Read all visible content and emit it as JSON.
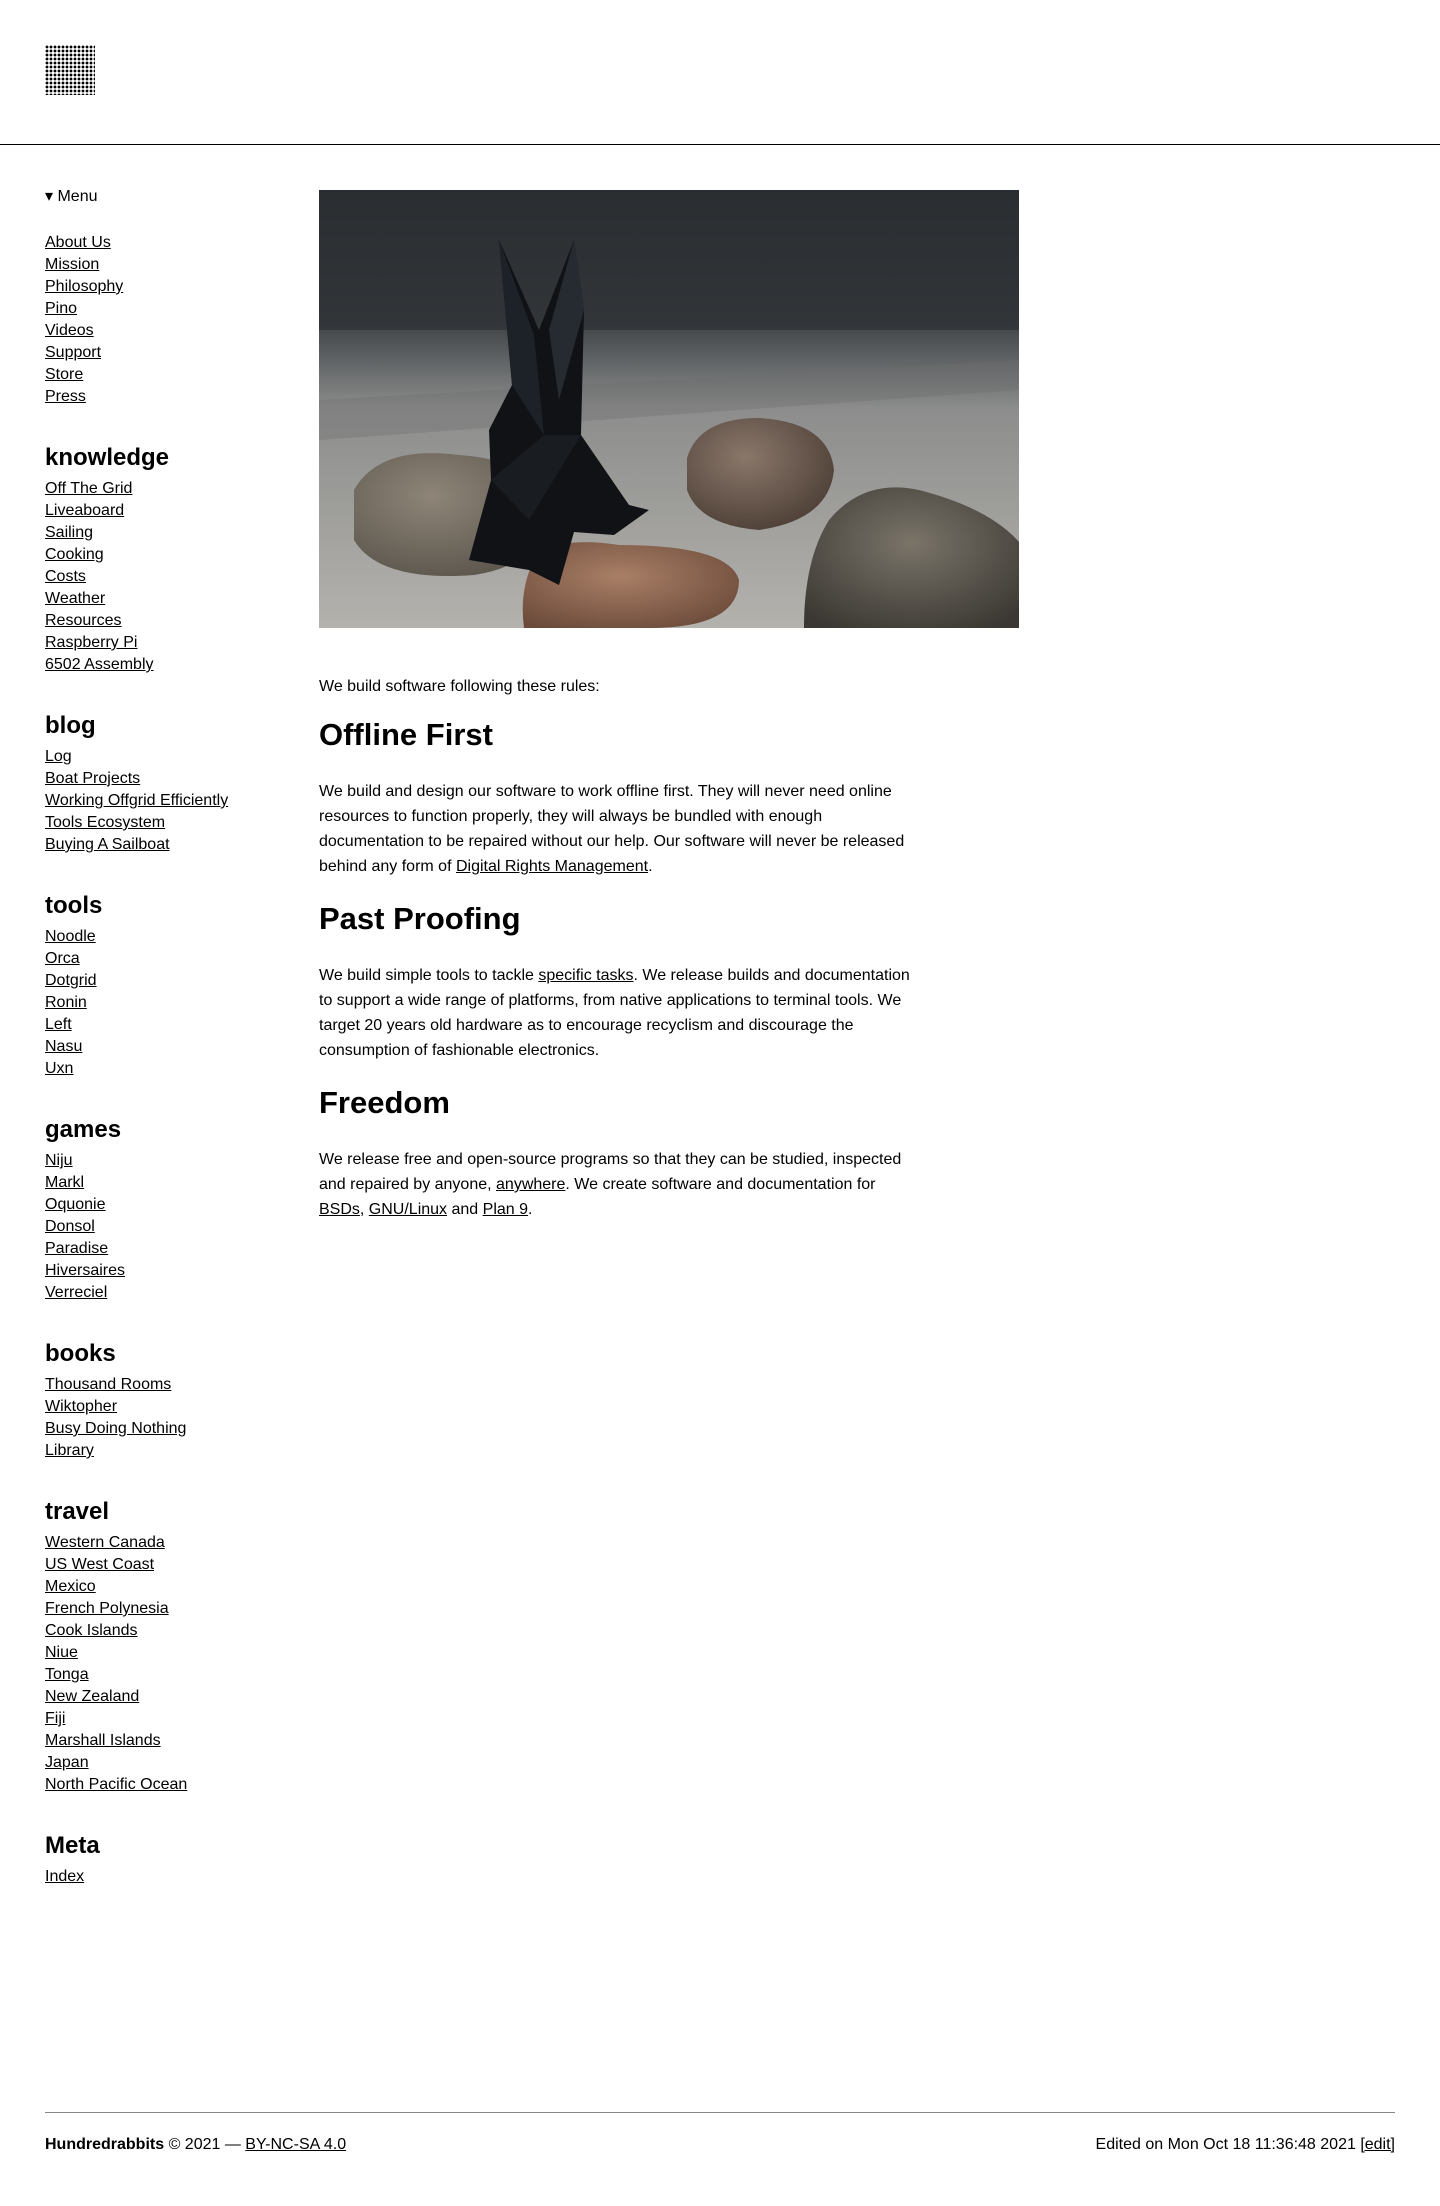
{
  "header": {
    "logo_icon": "dot-grid-logo-icon"
  },
  "nav": {
    "menu_label": "▾ Menu",
    "top_links": [
      "About Us",
      "Mission",
      "Philosophy",
      "Pino",
      "Videos",
      "Support",
      "Store",
      "Press"
    ],
    "groups": [
      {
        "title": "knowledge",
        "items": [
          "Off The Grid",
          "Liveaboard",
          "Sailing",
          "Cooking",
          "Costs",
          "Weather",
          "Resources",
          "Raspberry Pi",
          "6502 Assembly"
        ]
      },
      {
        "title": "blog",
        "items": [
          "Log",
          "Boat Projects",
          "Working Offgrid Efficiently",
          "Tools Ecosystem",
          "Buying A Sailboat"
        ]
      },
      {
        "title": "tools",
        "items": [
          "Noodle",
          "Orca",
          "Dotgrid",
          "Ronin",
          "Left",
          "Nasu",
          "Uxn"
        ]
      },
      {
        "title": "games",
        "items": [
          "Niju",
          "Markl",
          "Oquonie",
          "Donsol",
          "Paradise",
          "Hiversaires",
          "Verreciel"
        ]
      },
      {
        "title": "books",
        "items": [
          "Thousand Rooms",
          "Wiktopher",
          "Busy Doing Nothing",
          "Library"
        ]
      },
      {
        "title": "travel",
        "items": [
          "Western Canada",
          "US West Coast",
          "Mexico",
          "French Polynesia",
          "Cook Islands",
          "Niue",
          "Tonga",
          "New Zealand",
          "Fiji",
          "Marshall Islands",
          "Japan",
          "North Pacific Ocean"
        ]
      },
      {
        "title": "Meta",
        "items": [
          "Index"
        ]
      }
    ]
  },
  "main": {
    "intro": "We build software following these rules:",
    "sections": [
      {
        "title": "Offline First",
        "parts": [
          {
            "t": "We build and design our software to work offline first. They will never need online resources to function properly, they will always be bundled with enough documentation to be repaired without our help. Our software will never be released behind any form of "
          },
          {
            "t": "Digital Rights Management",
            "link": true
          },
          {
            "t": "."
          }
        ]
      },
      {
        "title": "Past Proofing",
        "parts": [
          {
            "t": "We build simple tools to tackle "
          },
          {
            "t": "specific tasks",
            "link": true
          },
          {
            "t": ". We release builds and documentation to support a wide range of platforms, from native applications to terminal tools. We target 20 years old hardware as to encourage recyclism and discourage the consumption of fashionable electronics."
          }
        ]
      },
      {
        "title": "Freedom",
        "parts": [
          {
            "t": "We release free and open-source programs so that they can be studied, inspected and repaired by anyone, "
          },
          {
            "t": "anywhere",
            "link": true
          },
          {
            "t": ". We create software and documentation for "
          },
          {
            "t": "BSDs",
            "link": true
          },
          {
            "t": ", "
          },
          {
            "t": "GNU/Linux",
            "link": true
          },
          {
            "t": " and "
          },
          {
            "t": "Plan 9",
            "link": true
          },
          {
            "t": "."
          }
        ]
      }
    ]
  },
  "footer": {
    "brand": "Hundredrabbits",
    "copyright": " © 2021 — ",
    "license": "BY-NC-SA 4.0",
    "edited": "Edited on Mon Oct 18 11:36:48 2021 ",
    "edit_link": "[edit]"
  }
}
